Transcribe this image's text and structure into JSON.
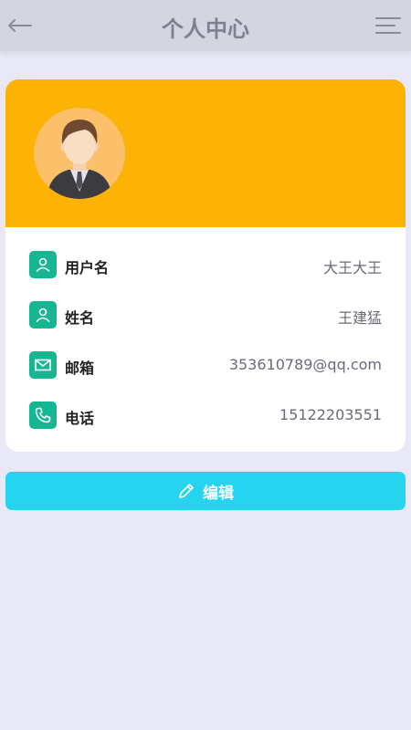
{
  "header": {
    "title": "个人中心",
    "back_icon": "arrow-left-icon",
    "menu_icon": "menu-icon"
  },
  "profile": {
    "avatar_icon": "user-avatar",
    "header_color": "#fdb305",
    "rows": [
      {
        "label": "用户名",
        "value": "大王大王",
        "icon": "user-icon"
      },
      {
        "label": "姓名",
        "value": "王建猛",
        "icon": "user-icon"
      },
      {
        "label": "邮箱",
        "value": "353610789@qq.com",
        "icon": "mail-icon"
      },
      {
        "label": "电话",
        "value": "15122203551",
        "icon": "phone-icon"
      }
    ]
  },
  "actions": {
    "edit_label": "编辑",
    "edit_icon": "pencil-icon",
    "edit_color": "#25d5ef"
  },
  "colors": {
    "background": "#e8e8f6",
    "accent": "#17b693"
  }
}
